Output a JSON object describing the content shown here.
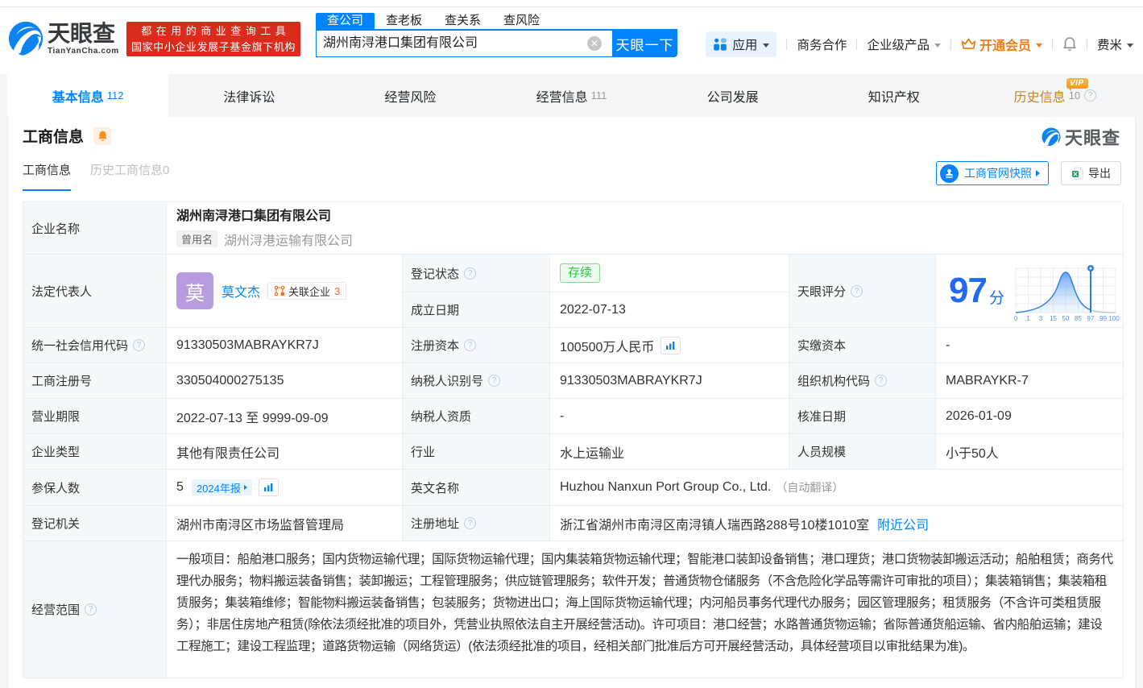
{
  "header": {
    "logo": {
      "brand": "天眼查",
      "domain": "TianYanCha.com"
    },
    "promo": {
      "line1": "都在用的商业查询工具",
      "line2": "国家中小企业发展子基金旗下机构"
    },
    "search": {
      "tabs": [
        "查公司",
        "查老板",
        "查关系",
        "查风险"
      ],
      "active_tab": "查公司",
      "input_value": "湖州南浔港口集团有限公司",
      "button_label": "天眼一下"
    },
    "menu": {
      "apps": "应用",
      "cooperation": "商务合作",
      "enterprise_products": "企业级产品",
      "vip": "开通会员",
      "user": "费米"
    }
  },
  "nav_tabs": {
    "basic": {
      "label": "基本信息",
      "count": "112"
    },
    "legal": {
      "label": "法律诉讼"
    },
    "risk": {
      "label": "经营风险"
    },
    "operating": {
      "label": "经营信息",
      "count": "111"
    },
    "development": {
      "label": "公司发展"
    },
    "ip": {
      "label": "知识产权"
    },
    "history": {
      "label": "历史信息",
      "count": "10",
      "vip_badge": "VIP"
    }
  },
  "section": {
    "title": "工商信息",
    "watermark": "天眼查",
    "subtab_active": "工商信息",
    "subtab_history": "历史工商信息0",
    "snapshot_button": "工商官网快照",
    "export_button": "导出"
  },
  "table": {
    "company_name": {
      "label": "企业名称",
      "value": "湖州南浔港口集团有限公司",
      "former_tag": "曾用名",
      "former_name": "湖州浔港运输有限公司"
    },
    "legal_rep": {
      "label": "法定代表人",
      "avatar_char": "莫",
      "name": "莫文杰",
      "chip_label": "关联企业",
      "chip_count": "3"
    },
    "reg_status": {
      "label": "登记状态",
      "value": "存续"
    },
    "establish_date": {
      "label": "成立日期",
      "value": "2022-07-13"
    },
    "score": {
      "label": "天眼评分",
      "value": "97",
      "unit": "分",
      "axis_labels": [
        "0",
        "1",
        "3",
        "15",
        "50",
        "85",
        "97",
        "99",
        "100"
      ]
    },
    "credit_code": {
      "label": "统一社会信用代码",
      "value": "91330503MABRAYKR7J"
    },
    "reg_capital": {
      "label": "注册资本",
      "value": "100500万人民币"
    },
    "paid_capital": {
      "label": "实缴资本",
      "value": "-"
    },
    "reg_number": {
      "label": "工商注册号",
      "value": "330504000275135"
    },
    "taxpayer_id": {
      "label": "纳税人识别号",
      "value": "91330503MABRAYKR7J"
    },
    "org_code": {
      "label": "组织机构代码",
      "value": "MABRAYKR-7"
    },
    "business_term": {
      "label": "营业期限",
      "value": "2022-07-13 至 9999-09-09"
    },
    "taxpayer_quality": {
      "label": "纳税人资质",
      "value": "-"
    },
    "approval_date": {
      "label": "核准日期",
      "value": "2026-01-09"
    },
    "company_type": {
      "label": "企业类型",
      "value": "其他有限责任公司"
    },
    "industry": {
      "label": "行业",
      "value": "水上运输业"
    },
    "staff_size": {
      "label": "人员规模",
      "value": "小于50人"
    },
    "insured_count": {
      "label": "参保人数",
      "value": "5",
      "report_chip": "2024年报"
    },
    "english_name": {
      "label": "英文名称",
      "value": "Huzhou Nanxun Port Group Co., Ltd.",
      "note": "（自动翻译）"
    },
    "reg_authority": {
      "label": "登记机关",
      "value": "湖州市南浔区市场监督管理局"
    },
    "reg_address": {
      "label": "注册地址",
      "value": "浙江省湖州市南浔区南浔镇人瑞西路288号10楼1010室",
      "link": "附近公司"
    },
    "business_scope": {
      "label": "经营范围",
      "value": "一般项目：船舶港口服务；国内货物运输代理；国际货物运输代理；国内集装箱货物运输代理；智能港口装卸设备销售；港口理货；港口货物装卸搬运活动；船舶租赁；商务代理代办服务；物料搬运装备销售；装卸搬运；工程管理服务；供应链管理服务；软件开发；普通货物仓储服务（不含危险化学品等需许可审批的项目）；集装箱销售；集装箱租赁服务；集装箱维修；智能物料搬运装备销售；包装服务；货物进出口；海上国际货物运输代理；内河船员事务代理代办服务；园区管理服务；租赁服务（不含许可类租赁服务）；非居住房地产租赁(除依法须经批准的项目外，凭营业执照依法自主开展经营活动)。许可项目：港口经营；水路普通货物运输；省际普通货船运输、省内船舶运输；建设工程施工；建设工程监理；道路货物运输（网络货运）(依法须经批准的项目，经相关部门批准后方可开展经营活动，具体经营项目以审批结果为准)。"
    }
  },
  "colors": {
    "brand_blue": "#0084ff",
    "score_blue": "#2169f1",
    "promo_red": "#db2b1d",
    "vip_orange": "#ec8013",
    "history_tab": "#c9821f",
    "status_green": "#30bf47",
    "label_bg": "#f3f9fc"
  }
}
